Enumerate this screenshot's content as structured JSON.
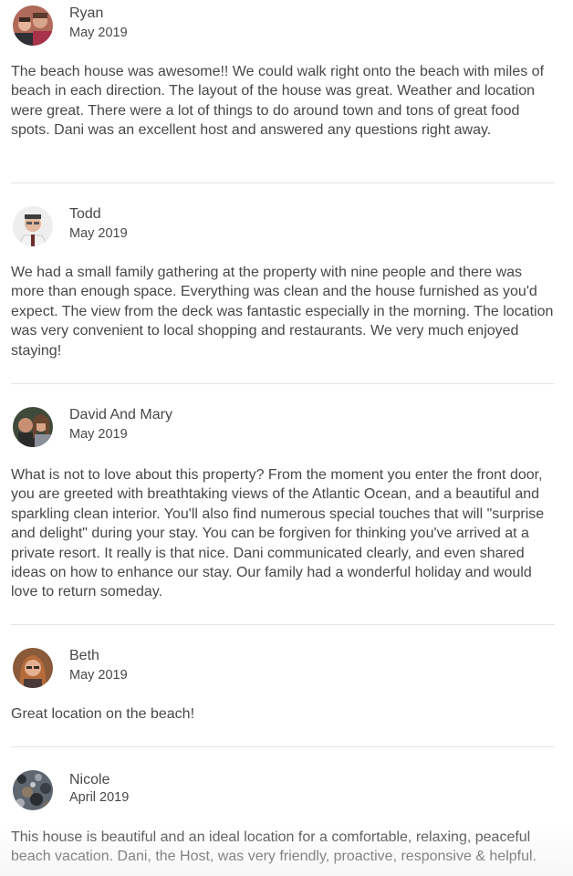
{
  "reviews": [
    {
      "name": "Ryan",
      "date": "May 2019",
      "text": "The beach house was awesome!! We could walk right onto the beach with miles of beach in each direction. The layout of the house was great. Weather and location were great. There were a lot of things to do around town and tons of great food spots. Dani was an excellent host and answered any questions right away."
    },
    {
      "name": "Todd",
      "date": "May 2019",
      "text": "We had a small family gathering at the property with nine people and there was more than enough space. Everything was clean and the house furnished as you'd expect. The view from the deck was fantastic especially in the morning. The location was very convenient to local shopping and restaurants. We very much enjoyed staying!"
    },
    {
      "name": "David And Mary",
      "date": "May 2019",
      "text": "What is not to love about this property? From the moment you enter the front door, you are greeted with breathtaking views of the Atlantic Ocean, and a beautiful and sparkling clean interior. You'll also find numerous special touches that will \"surprise and delight\" during your stay. You can be forgiven for thinking you've arrived at a private resort. It really is that nice. Dani communicated clearly, and even shared ideas on how to enhance our stay. Our family had a wonderful holiday and would love to return someday."
    },
    {
      "name": "Beth",
      "date": "May 2019",
      "text": "Great location on the beach!"
    },
    {
      "name": "Nicole",
      "date": "April 2019",
      "text": "This house is beautiful and an ideal location for a comfortable, relaxing, peaceful beach vacation. Dani, the Host, was very friendly, proactive, responsive & helpful."
    }
  ]
}
